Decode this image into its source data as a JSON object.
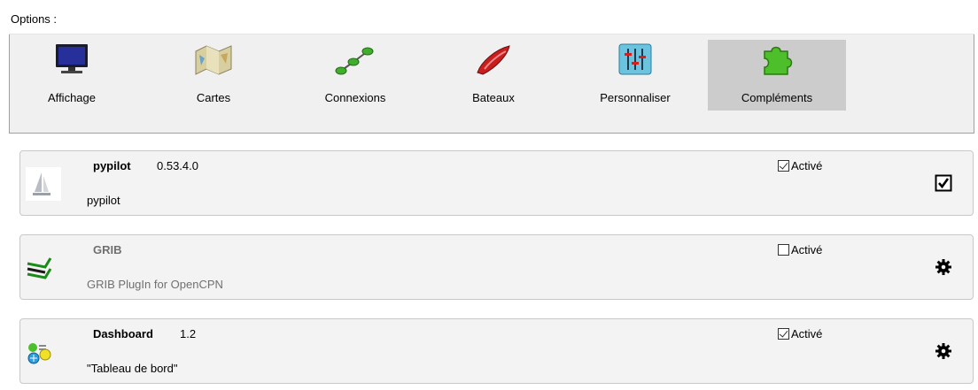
{
  "options_label": "Options :",
  "toolbar": {
    "items": [
      {
        "label": "Affichage",
        "icon": "monitor-icon"
      },
      {
        "label": "Cartes",
        "icon": "charts-icon"
      },
      {
        "label": "Connexions",
        "icon": "connections-icon"
      },
      {
        "label": "Bateaux",
        "icon": "boat-icon"
      },
      {
        "label": "Personnaliser",
        "icon": "sliders-icon"
      },
      {
        "label": "Compléments",
        "icon": "puzzle-icon",
        "selected": true
      }
    ]
  },
  "plugins": [
    {
      "name": "pypilot",
      "version": "0.53.4.0",
      "description": "pypilot",
      "enabled_label": "Activé",
      "enabled": true,
      "icon": "sailboat-icon",
      "action_icon": "checkbox-checked-icon"
    },
    {
      "name": "GRIB",
      "version": "",
      "description": "GRIB PlugIn for OpenCPN",
      "enabled_label": "Activé",
      "enabled": false,
      "icon": "grib-icon",
      "action_icon": "gear-icon"
    },
    {
      "name": "Dashboard",
      "version": "1.2",
      "description": "\"Tableau de bord\"",
      "enabled_label": "Activé",
      "enabled": true,
      "icon": "dashboard-icon",
      "action_icon": "gear-icon"
    }
  ],
  "colors": {
    "selected_tab": "#cccccc",
    "panel_bg": "#f3f3f3"
  }
}
